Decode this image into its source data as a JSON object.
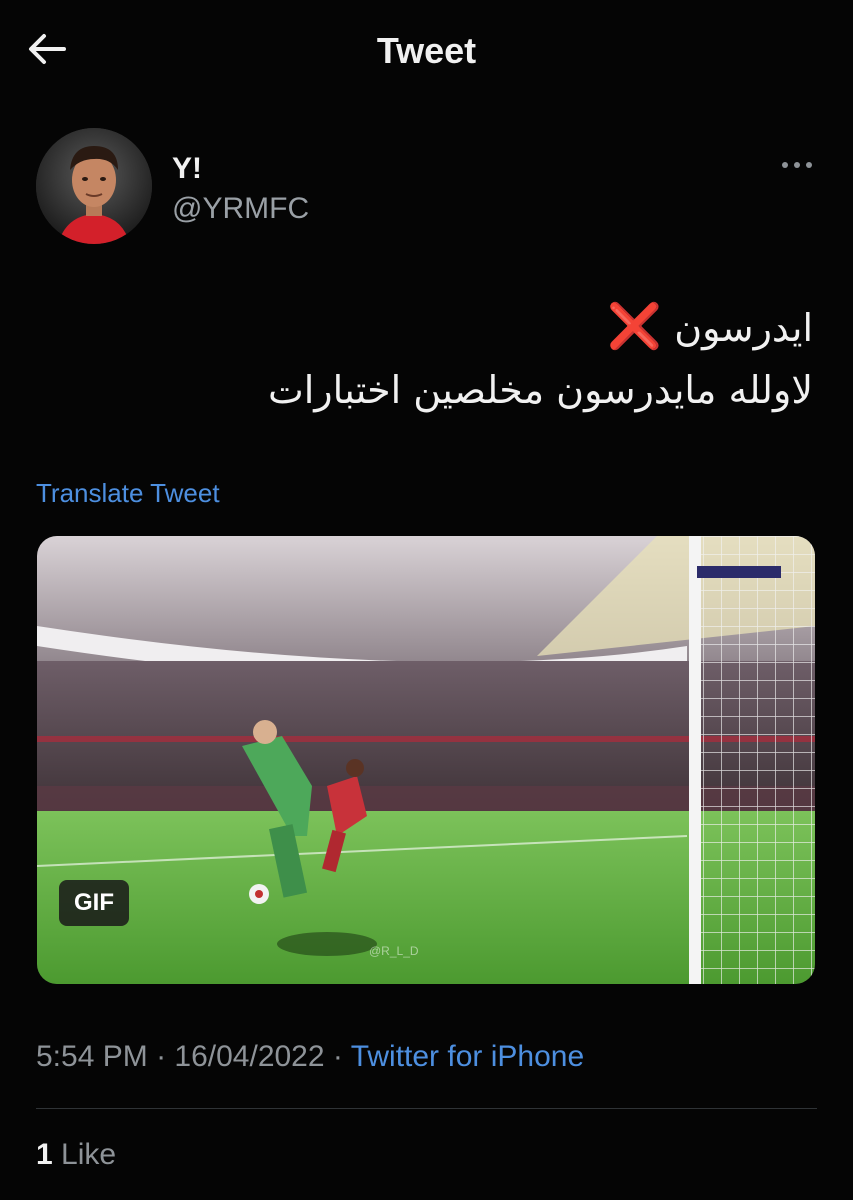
{
  "header": {
    "title": "Tweet",
    "back_icon": "back-arrow-icon"
  },
  "author": {
    "name": "Y!",
    "handle": "@YRMFC",
    "avatar": "profile-photo"
  },
  "tweet": {
    "line1_text": "ايدرسون",
    "line1_mark": "❌",
    "line2": "لاولله مايدرسون مخلصين اختبارات"
  },
  "translate_label": "Translate Tweet",
  "media": {
    "badge": "GIF",
    "watermark": "@R_L_D"
  },
  "meta": {
    "time": "5:54 PM",
    "sep1": " · ",
    "date": "16/04/2022",
    "sep2": " · ",
    "source": "Twitter for iPhone"
  },
  "stats": {
    "likes_count": "1",
    "likes_label": "Like"
  },
  "colors": {
    "accent": "#4d8fe0",
    "background": "#050505",
    "x_mark": "#e0302b",
    "pitch": "#5dae3e"
  }
}
